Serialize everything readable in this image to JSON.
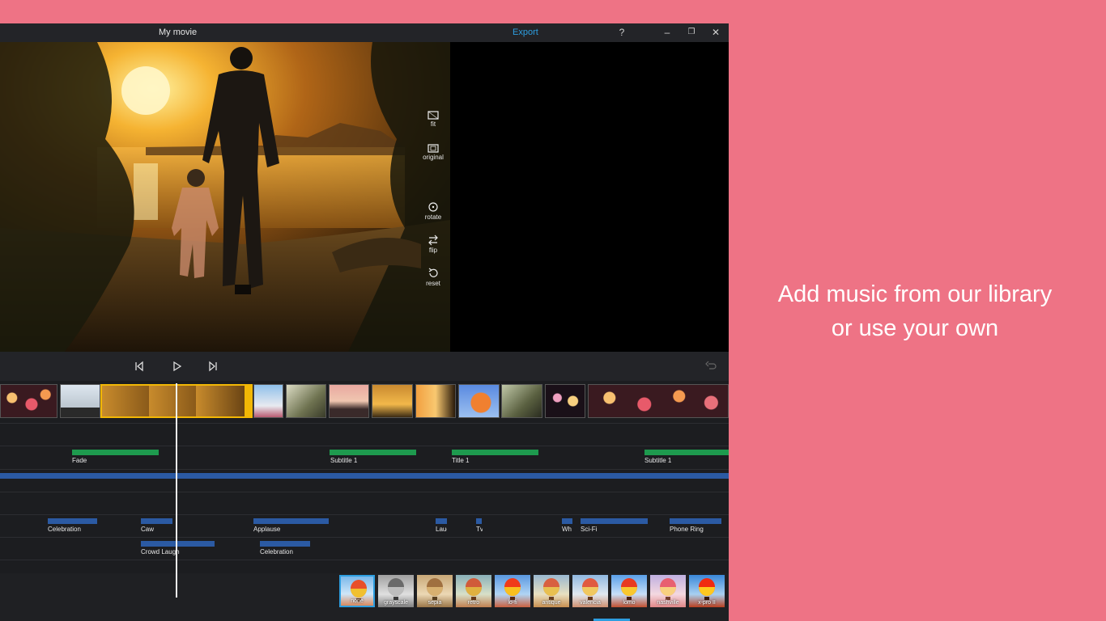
{
  "window": {
    "title": "My movie",
    "export_label": "Export",
    "help_label": "?",
    "minimize_label": "–",
    "restore_label": "❐",
    "close_label": "✕"
  },
  "tools": [
    {
      "label": "fit",
      "icon": "fit-icon"
    },
    {
      "label": "original",
      "icon": "original-icon"
    },
    {
      "label": "rotate",
      "icon": "rotate-icon"
    },
    {
      "label": "flip",
      "icon": "flip-icon"
    },
    {
      "label": "reset",
      "icon": "reset-icon"
    }
  ],
  "transport": {
    "prev_icon": "skip-previous-icon",
    "play_icon": "play-icon",
    "next_icon": "skip-next-icon",
    "undo_icon": "undo-icon"
  },
  "timeline": {
    "text_clips": [
      "Fade",
      "Subtitle 1",
      "Title 1",
      "Subtitle 1"
    ],
    "sound_clips_row1": [
      "Celebration",
      "Caw",
      "Applause",
      "Laug",
      "Tv",
      "Wh",
      "Sci-Fi",
      "Phone Ring"
    ],
    "sound_clips_row2": [
      "Crowd Laugh",
      "Celebration"
    ]
  },
  "filters": [
    "none",
    "grayscale",
    "sepia",
    "retro",
    "lo-fi",
    "antique",
    "valencia",
    "lomo",
    "nashville",
    "x-pro II"
  ],
  "caption": {
    "line1": "Add music from our library",
    "line2": "or use your own"
  },
  "colors": {
    "background": "#ee7385",
    "accent": "#2d9ee0",
    "text_track": "#1e9a4e",
    "audio_track": "#2b5aa3",
    "selected_clip": "#f2b705"
  }
}
